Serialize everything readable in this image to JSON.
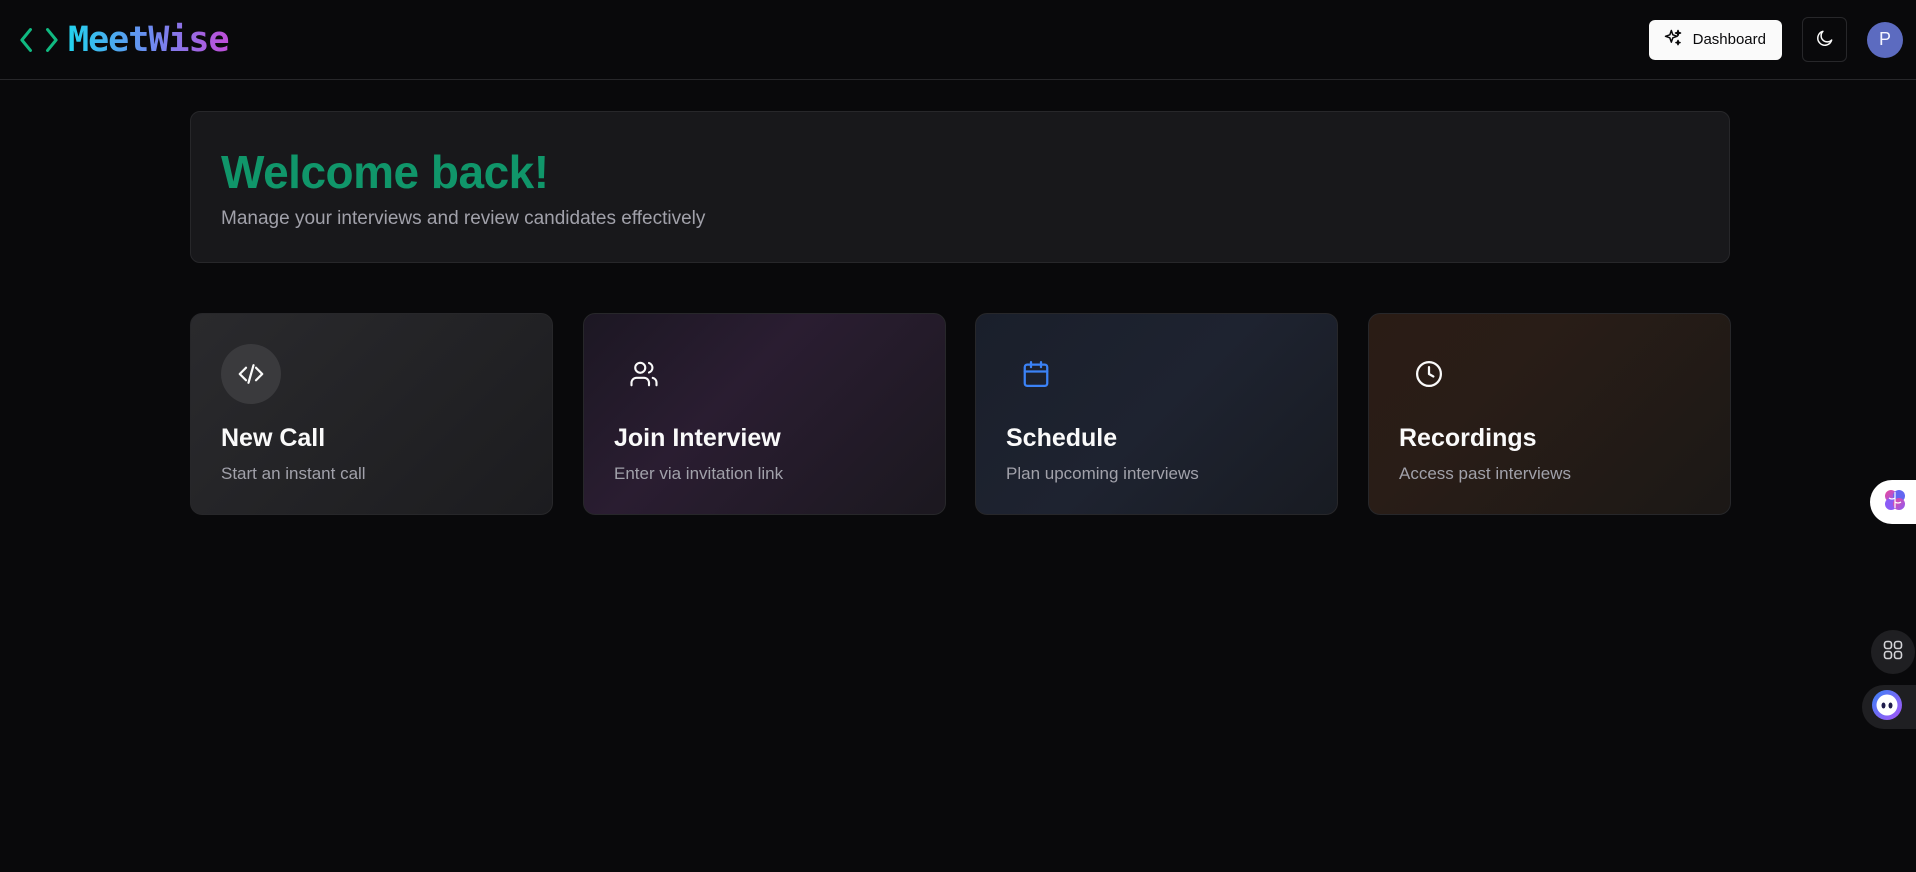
{
  "header": {
    "brand_name": "MeetWise",
    "dashboard_label": "Dashboard",
    "avatar_initial": "P"
  },
  "welcome": {
    "title": "Welcome back!",
    "subtitle": "Manage your interviews and review candidates effectively"
  },
  "cards": [
    {
      "title": "New Call",
      "description": "Start an instant call",
      "icon": "code-icon"
    },
    {
      "title": "Join Interview",
      "description": "Enter via invitation link",
      "icon": "users-icon"
    },
    {
      "title": "Schedule",
      "description": "Plan upcoming interviews",
      "icon": "calendar-icon"
    },
    {
      "title": "Recordings",
      "description": "Access past interviews",
      "icon": "clock-icon"
    }
  ],
  "colors": {
    "background": "#09090b",
    "welcome_title": "#10966a",
    "schedule_icon": "#3b82f6",
    "avatar": "#5c6bc0"
  }
}
